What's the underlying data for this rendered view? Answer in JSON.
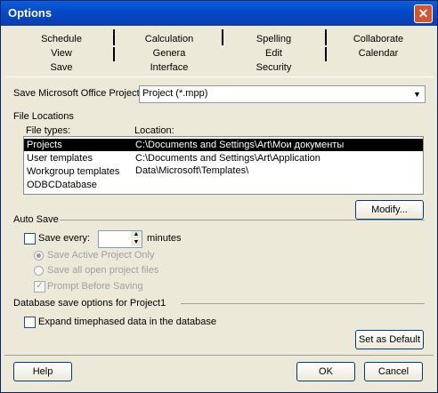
{
  "window": {
    "title": "Options",
    "close_icon": "close-icon"
  },
  "tabs": {
    "row1": [
      "Schedule",
      "Calculation",
      "Spelling",
      "Collaborate"
    ],
    "row2": [
      "View",
      "Genera",
      "Edit",
      "Calendar"
    ],
    "row3": [
      "Save",
      "Interface",
      "Security"
    ]
  },
  "save_format": {
    "label": "Save Microsoft Office Project",
    "value": "Project (*.mpp)"
  },
  "file_locations": {
    "heading": "File Locations",
    "col_types": "File types:",
    "col_location": "Location:",
    "rows": [
      {
        "type": "Projects",
        "location": "C:\\Documents and Settings\\Art\\Мои документы"
      },
      {
        "type": "User templates",
        "location": "C:\\Documents and Settings\\Art\\Application Data\\Microsoft\\Templates\\"
      },
      {
        "type": "Workgroup templates",
        "location": ""
      },
      {
        "type": "ODBCDatabase",
        "location": ""
      }
    ],
    "modify_label": "Modify..."
  },
  "auto_save": {
    "heading": "Auto Save",
    "save_every_label": "Save every:",
    "minutes_value": "",
    "minutes_label": "minutes",
    "save_active_label": "Save Active Project Only",
    "save_all_label": "Save all open project files",
    "prompt_label": "Prompt Before Saving"
  },
  "database": {
    "heading": "Database save options for Project1",
    "expand_label": "Expand timephased data in the database",
    "set_default_label": "Set as Default"
  },
  "footer": {
    "help_label": "Help",
    "ok_label": "OK",
    "cancel_label": "Cancel"
  }
}
